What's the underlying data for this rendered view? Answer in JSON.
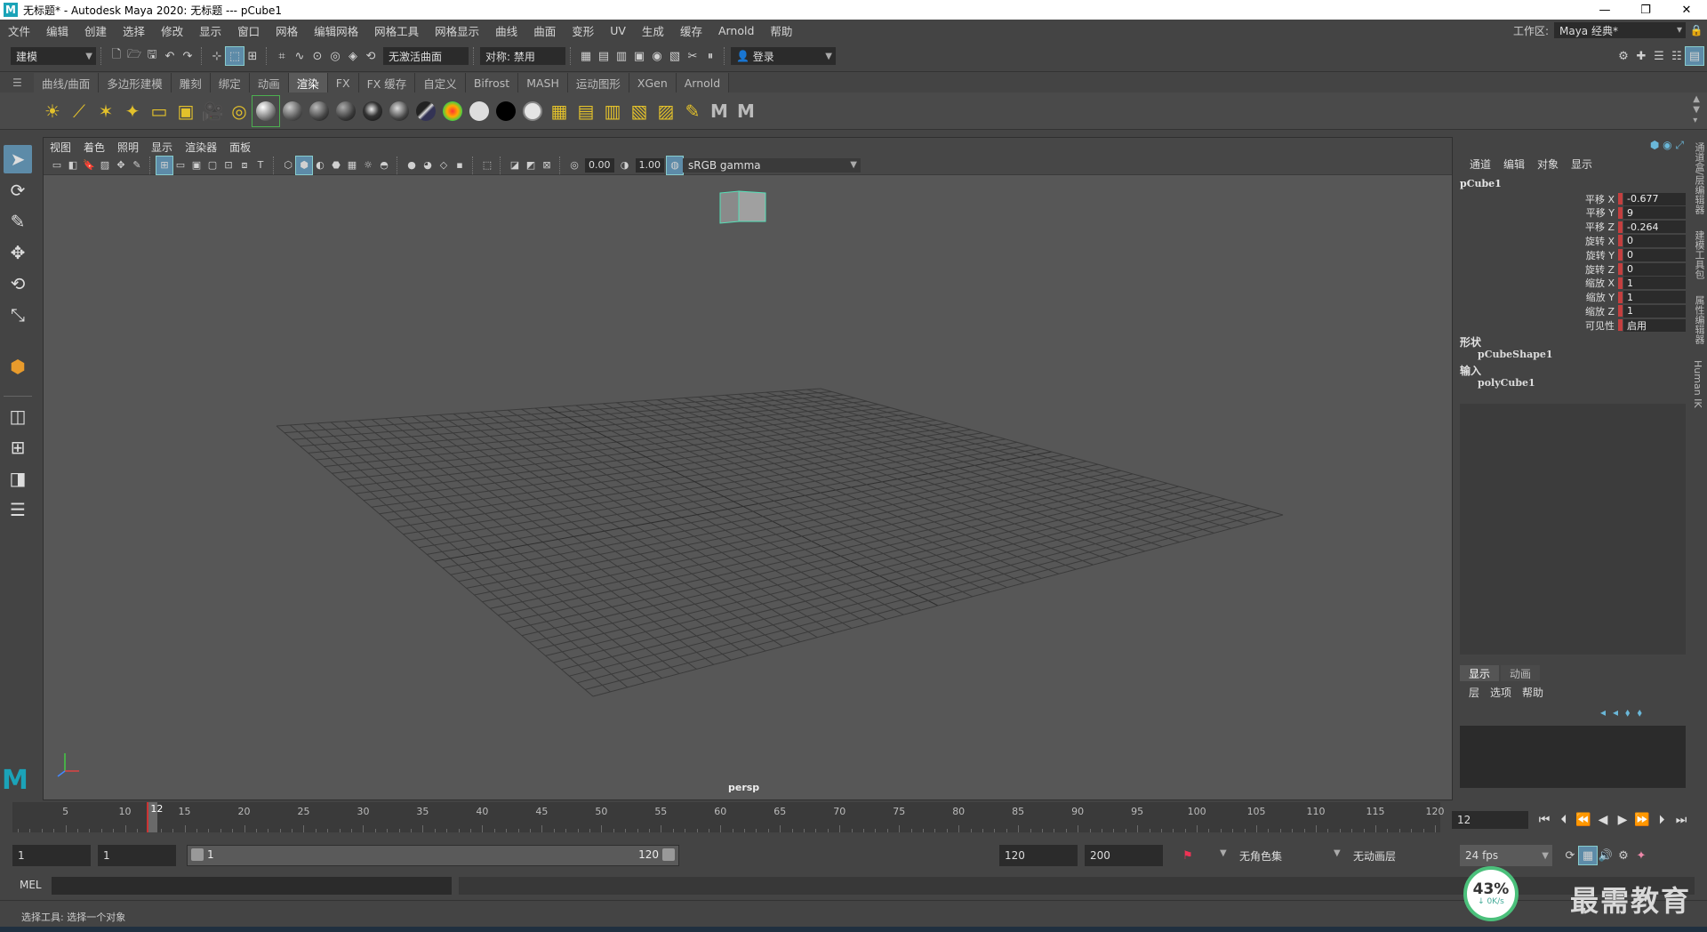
{
  "window": {
    "title": "无标题* - Autodesk Maya 2020: 无标题   ---   pCube1",
    "controls": [
      "—",
      "❐",
      "✕"
    ]
  },
  "menubar": {
    "items": [
      "文件",
      "编辑",
      "创建",
      "选择",
      "修改",
      "显示",
      "窗口",
      "网格",
      "编辑网格",
      "网格工具",
      "网格显示",
      "曲线",
      "曲面",
      "变形",
      "UV",
      "生成",
      "缓存",
      "Arnold",
      "帮助"
    ],
    "workspace_label": "工作区:",
    "workspace_value": "Maya 经典*"
  },
  "statusline": {
    "mode": "建模",
    "live_surface": "无激活曲面",
    "symmetry": "对称: 禁用",
    "login": "登录"
  },
  "shelf": {
    "tabs": [
      "曲线/曲面",
      "多边形建模",
      "雕刻",
      "绑定",
      "动画",
      "渲染",
      "FX",
      "FX 缓存",
      "自定义",
      "Bifrost",
      "MASH",
      "运动图形",
      "XGen",
      "Arnold"
    ],
    "active_tab": "渲染"
  },
  "viewport": {
    "menus": [
      "视图",
      "着色",
      "照明",
      "显示",
      "渲染器",
      "面板"
    ],
    "exposure": "0.00",
    "gamma": "1.00",
    "colorspace": "sRGB gamma",
    "camera_label": "persp"
  },
  "channelbox": {
    "menus": [
      "通道",
      "编辑",
      "对象",
      "显示"
    ],
    "object": "pCube1",
    "attributes": [
      {
        "name": "平移 X",
        "value": "-0.677"
      },
      {
        "name": "平移 Y",
        "value": "9"
      },
      {
        "name": "平移 Z",
        "value": "-0.264"
      },
      {
        "name": "旋转 X",
        "value": "0"
      },
      {
        "name": "旋转 Y",
        "value": "0"
      },
      {
        "name": "旋转 Z",
        "value": "0"
      },
      {
        "name": "缩放 X",
        "value": "1"
      },
      {
        "name": "缩放 Y",
        "value": "1"
      },
      {
        "name": "缩放 Z",
        "value": "1"
      },
      {
        "name": "可见性",
        "value": "启用"
      }
    ],
    "shape_header": "形状",
    "shape_node": "pCubeShape1",
    "input_header": "输入",
    "input_node": "polyCube1"
  },
  "layereditor": {
    "tabs": [
      "显示",
      "动画"
    ],
    "menus": [
      "层",
      "选项",
      "帮助"
    ]
  },
  "side_tabs": [
    "通道盒/层编辑器",
    "建模工具包",
    "属性编辑器",
    "Human IK"
  ],
  "timeline": {
    "labels": [
      "5",
      "10",
      "15",
      "20",
      "25",
      "30",
      "35",
      "40",
      "45",
      "50",
      "55",
      "60",
      "65",
      "70",
      "75",
      "80",
      "85",
      "90",
      "95",
      "100",
      "105",
      "110",
      "115",
      "120"
    ],
    "current_frame": "12"
  },
  "range": {
    "anim_start": "1",
    "playback_start": "1",
    "slider_start": "1",
    "slider_end": "120",
    "playback_end": "120",
    "anim_end": "200",
    "character_set": "无角色集",
    "anim_layer": "无动画层",
    "fps": "24 fps"
  },
  "cmdline": {
    "label": "MEL"
  },
  "helpline": {
    "text": "选择工具: 选择一个对象"
  },
  "overlay": {
    "net_percent": "43%",
    "net_speed": "↓ 0K/s",
    "watermark": "最需教育"
  }
}
